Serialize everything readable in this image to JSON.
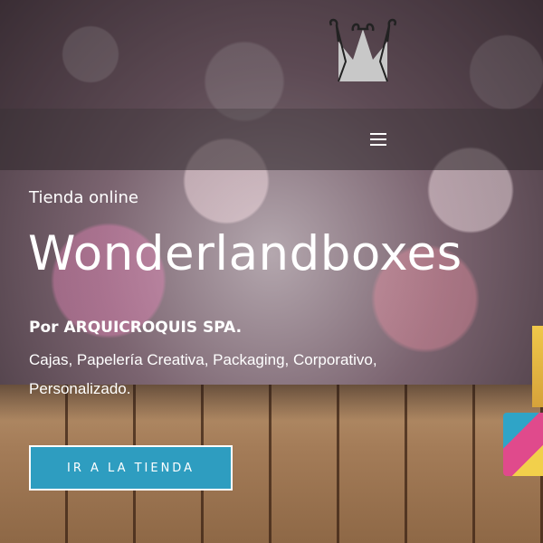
{
  "header": {
    "logo_icon": "crown-icon",
    "menu_icon": "hamburger-menu-icon"
  },
  "hero": {
    "eyebrow": "Tienda online",
    "title": "Wonderlandboxes",
    "byline": "Por ARQUICROQUIS SPA.",
    "description": "Cajas, Papelería Creativa, Packaging, Corporativo, Personalizado.",
    "cta_label": "IR A LA TIENDA"
  },
  "colors": {
    "accent": "#2e9dc0",
    "text": "#ffffff"
  }
}
